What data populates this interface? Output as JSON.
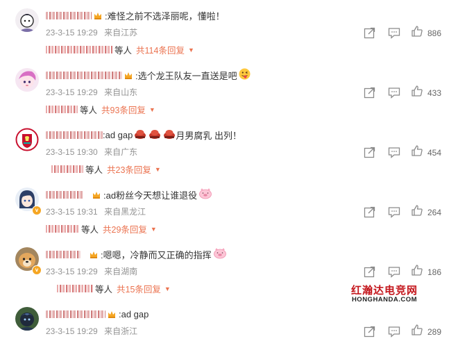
{
  "comments": [
    {
      "text": ":难怪之前不选泽丽呢，懂啦！",
      "emoji": "",
      "date": "23-3-15 19:29",
      "location": "来自江苏",
      "likes": "886",
      "reply_suffix": "等人",
      "reply_link": "共114条回复",
      "avatar": "cartoon-face",
      "has_badge": true
    },
    {
      "text": ":选个龙王队友一直送是吧",
      "emoji": "😜",
      "date": "23-3-15 19:29",
      "location": "来自山东",
      "likes": "433",
      "reply_suffix": "等人",
      "reply_link": "共93条回复",
      "avatar": "pink-character",
      "has_badge": true
    },
    {
      "text": ":ad gap",
      "text2": "月男腐乳 出列！",
      "emoji": "",
      "date": "23-3-15 19:30",
      "location": "来自广东",
      "likes": "454",
      "reply_suffix": "等人",
      "reply_link": "共23条回复",
      "avatar": "liverpool-crest",
      "has_badge": false
    },
    {
      "text": ":ad粉丝今天想让谁退役",
      "emoji": "🐷",
      "date": "23-3-15 19:31",
      "location": "来自黑龙江",
      "likes": "264",
      "reply_suffix": "等人",
      "reply_link": "共29条回复",
      "avatar": "anime-girl",
      "has_badge": true
    },
    {
      "text": ":嗯嗯，冷静而又正确的指挥",
      "emoji": "🐷",
      "date": "23-3-15 19:29",
      "location": "来自湖南",
      "likes": "186",
      "reply_suffix": "等人",
      "reply_link": "共15条回复",
      "avatar": "dog-photo",
      "has_badge": true
    },
    {
      "text": ":ad gap",
      "emoji": "",
      "date": "23-3-15 19:29",
      "location": "来自浙江",
      "likes": "289",
      "avatar": "dark-character",
      "has_badge": false
    }
  ],
  "watermark": {
    "line1": "红瀚达电竞网",
    "line2": "HONGHANDA.COM"
  },
  "colors": {
    "link": "#eb7350",
    "meta": "#939393",
    "watermark_red": "#c4161c"
  }
}
